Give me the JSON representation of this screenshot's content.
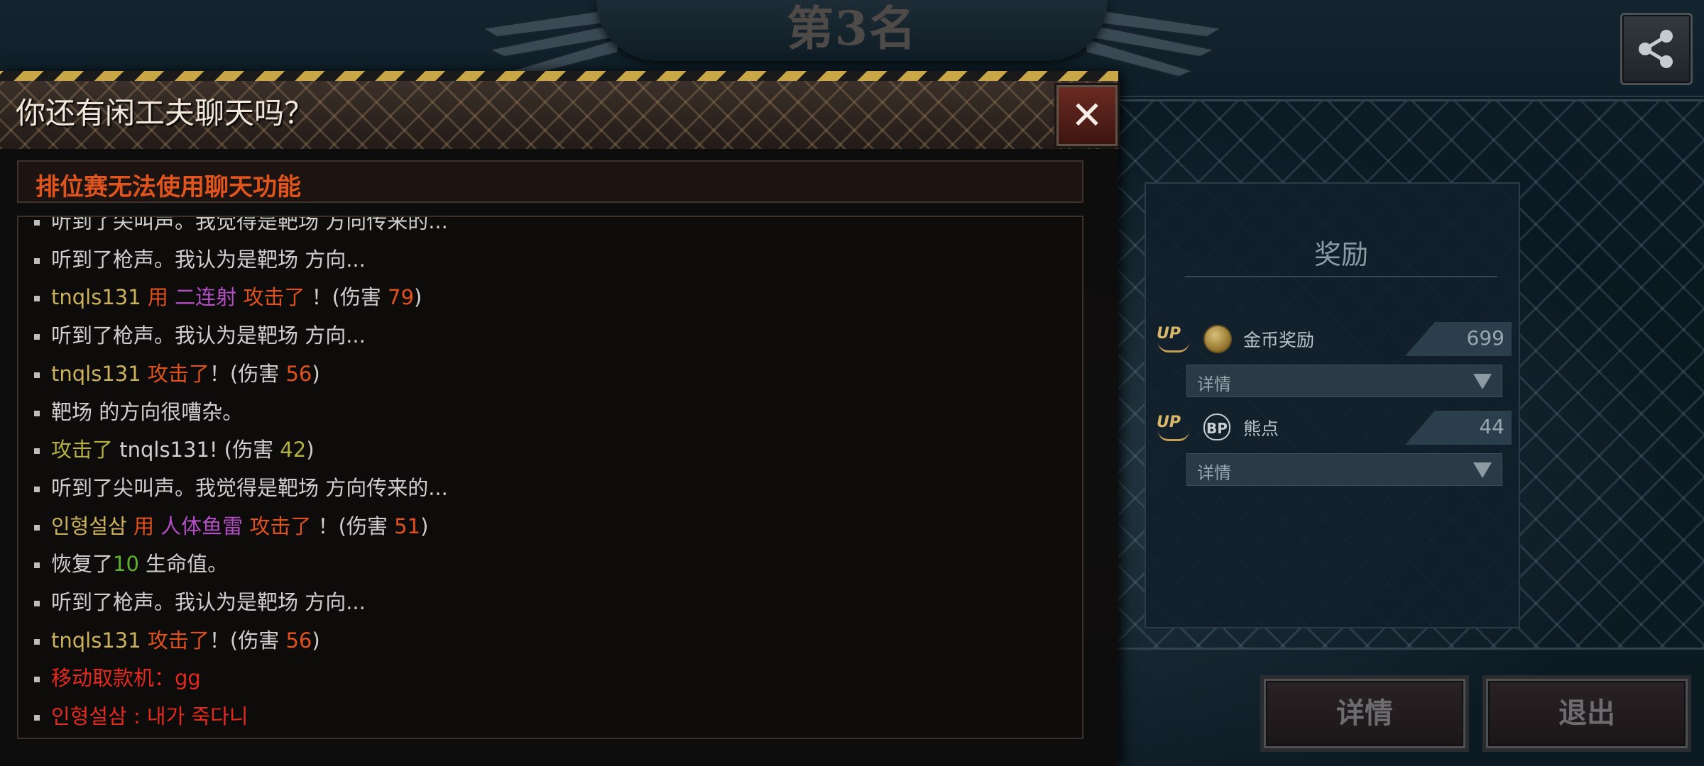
{
  "background": {
    "rank_title": "第3名"
  },
  "share": {
    "icon": "share-icon"
  },
  "chat": {
    "title": "你还有闲工夫聊天吗？",
    "close_label": "✕",
    "notice": "排位赛无法使用聊天功能",
    "lines": [
      {
        "segments": [
          {
            "text": "听到了尖叫声。我觉得是靶场 方向传来的...",
            "color": "white"
          }
        ]
      },
      {
        "segments": [
          {
            "text": "听到了枪声。我认为是靶场 方向...",
            "color": "white"
          }
        ]
      },
      {
        "segments": [
          {
            "text": "tnqls131",
            "color": "gold"
          },
          {
            "text": "  用 ",
            "color": "orange"
          },
          {
            "text": "二连射",
            "color": "purple"
          },
          {
            "text": "  攻击了",
            "color": "orange"
          },
          {
            "text": " ！(伤害 ",
            "color": "white"
          },
          {
            "text": "79",
            "color": "num"
          },
          {
            "text": ")",
            "color": "white"
          }
        ]
      },
      {
        "segments": [
          {
            "text": "听到了枪声。我认为是靶场 方向...",
            "color": "white"
          }
        ]
      },
      {
        "segments": [
          {
            "text": "tnqls131",
            "color": "gold"
          },
          {
            "text": "  攻击了",
            "color": "orange"
          },
          {
            "text": "！(伤害 ",
            "color": "white"
          },
          {
            "text": "56",
            "color": "num"
          },
          {
            "text": ")",
            "color": "white"
          }
        ]
      },
      {
        "segments": [
          {
            "text": "靶场 的方向很嘈杂。",
            "color": "white"
          }
        ]
      },
      {
        "segments": [
          {
            "text": "攻击了",
            "color": "olive"
          },
          {
            "text": " tnqls131! (伤害 ",
            "color": "white"
          },
          {
            "text": "42",
            "color": "olive"
          },
          {
            "text": ")",
            "color": "white"
          }
        ]
      },
      {
        "segments": [
          {
            "text": "听到了尖叫声。我觉得是靶场 方向传来的...",
            "color": "white"
          }
        ]
      },
      {
        "segments": [
          {
            "text": "인형설삼",
            "color": "gold"
          },
          {
            "text": "  用 ",
            "color": "orange"
          },
          {
            "text": "人体鱼雷",
            "color": "purple"
          },
          {
            "text": "  攻击了",
            "color": "orange"
          },
          {
            "text": " ！(伤害 ",
            "color": "white"
          },
          {
            "text": "51",
            "color": "num"
          },
          {
            "text": ")",
            "color": "white"
          }
        ]
      },
      {
        "segments": [
          {
            "text": "恢复了",
            "color": "white"
          },
          {
            "text": "10",
            "color": "green"
          },
          {
            "text": " 生命值。",
            "color": "white"
          }
        ]
      },
      {
        "segments": [
          {
            "text": "听到了枪声。我认为是靶场 方向...",
            "color": "white"
          }
        ]
      },
      {
        "segments": [
          {
            "text": "tnqls131",
            "color": "gold"
          },
          {
            "text": "  攻击了",
            "color": "orange"
          },
          {
            "text": "！(伤害 ",
            "color": "white"
          },
          {
            "text": "56",
            "color": "num"
          },
          {
            "text": ")",
            "color": "white"
          }
        ]
      },
      {
        "segments": [
          {
            "text": "移动取款机：gg",
            "color": "red"
          }
        ]
      },
      {
        "segments": [
          {
            "text": "인형설삼 : 내가 죽다니",
            "color": "red"
          }
        ]
      }
    ]
  },
  "rewards": {
    "title": "奖励",
    "items": [
      {
        "badge": "UP",
        "icon": "coin-icon",
        "label": "金币奖励",
        "value": "699",
        "detail": "详情"
      },
      {
        "badge": "UP",
        "icon": "bear-point-icon",
        "icon_glyph": "BP",
        "label": "熊点",
        "value": "44",
        "detail": "详情"
      }
    ]
  },
  "buttons": {
    "detail": "详情",
    "exit": "退出"
  },
  "colors": {
    "white": "#cfcfcf",
    "gold": "#cbb25a",
    "orange": "#e0521c",
    "purple": "#b24fc4",
    "olive": "#b3b040",
    "green": "#5fb32a",
    "red": "#e22a1d",
    "num": "#e0521c"
  }
}
